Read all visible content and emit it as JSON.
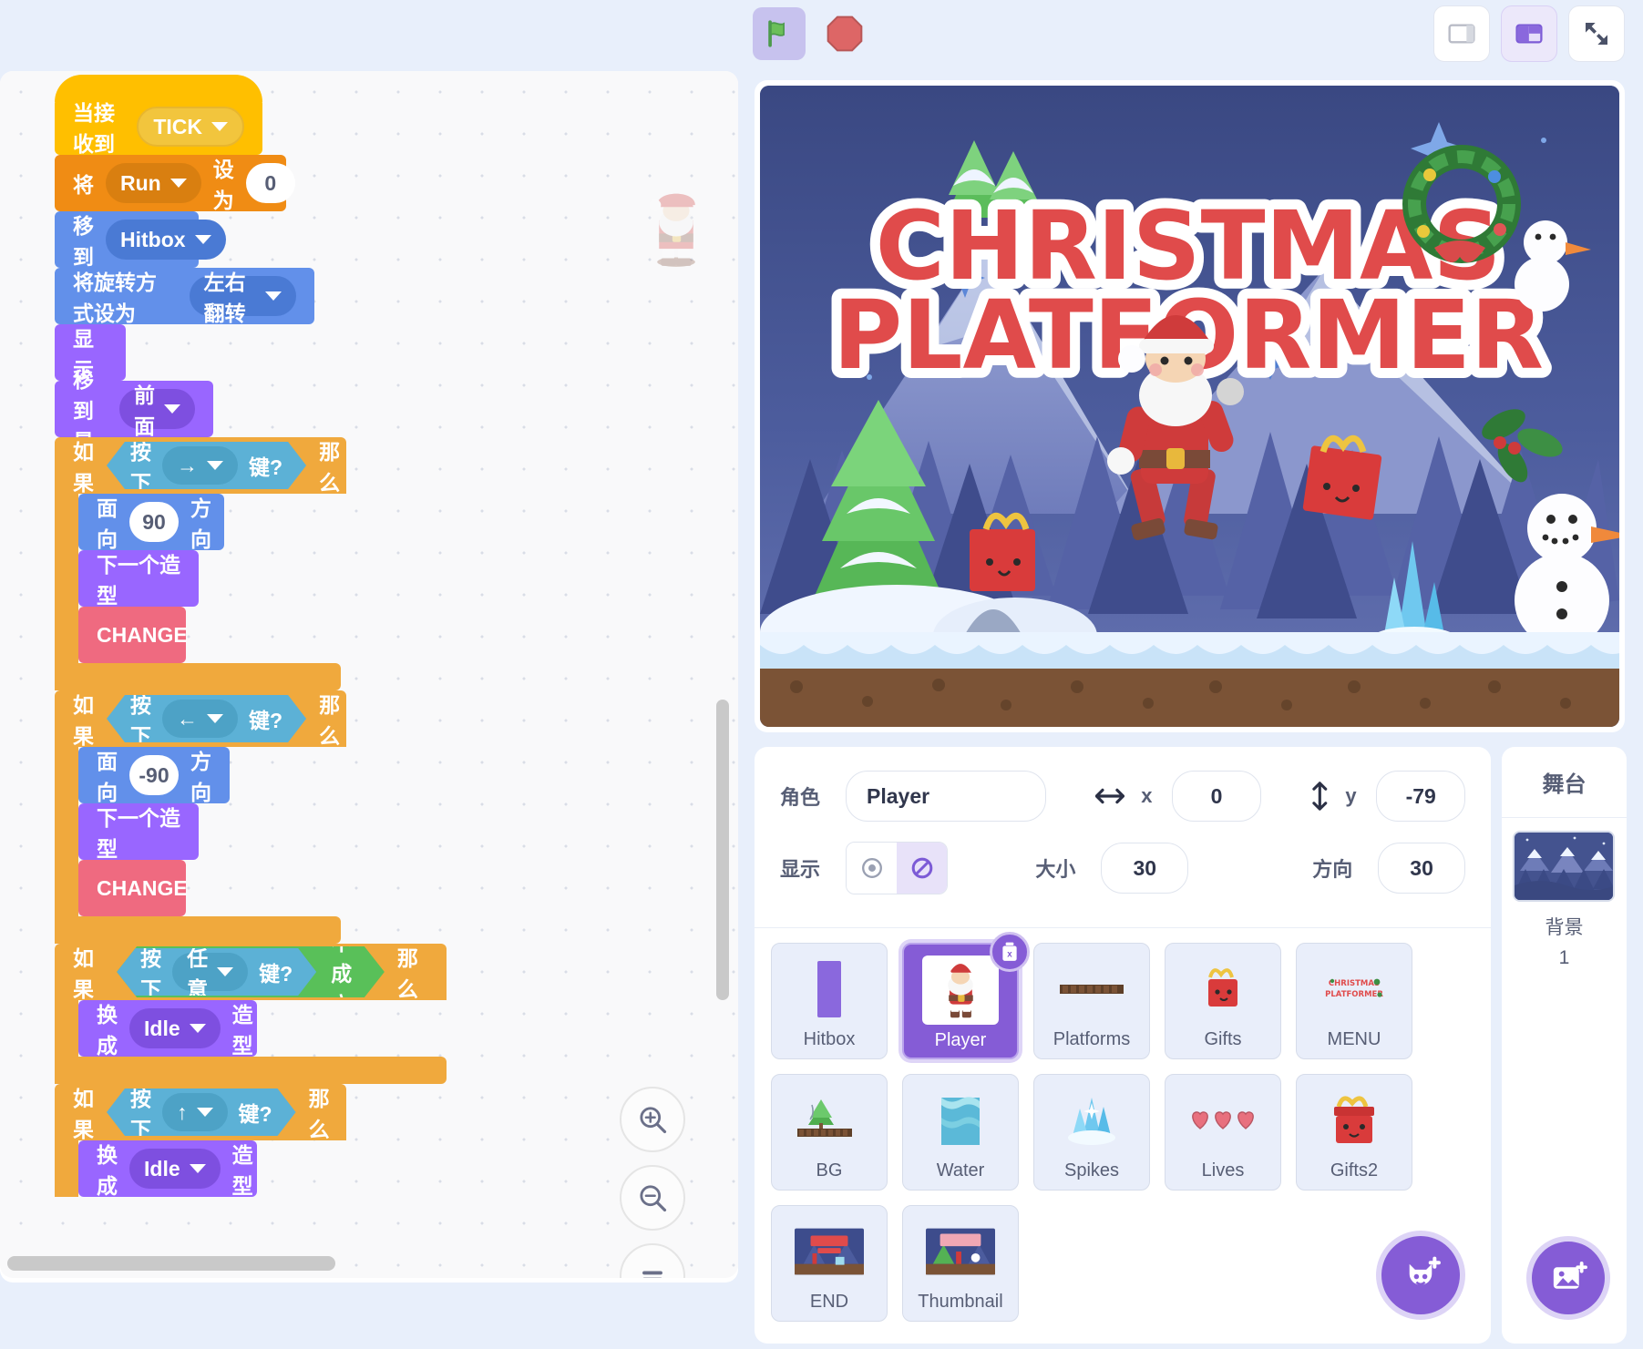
{
  "toolbar": {
    "green_flag": "green-flag-icon",
    "stop": "stop-icon",
    "layout_small": "layout-small-stage-icon",
    "layout_large": "layout-large-stage-icon",
    "fullscreen": "fullscreen-icon"
  },
  "code": {
    "blocks": {
      "when_receive": "当接收到",
      "tick_message": "TICK",
      "set": "将",
      "set_var": "Run",
      "set_to": "设为",
      "set_value": "0",
      "goto": "移到",
      "goto_target": "Hitbox",
      "set_rotation": "将旋转方式设为",
      "rotation_style": "左右翻转",
      "show": "显示",
      "go_to_layer": "移到最",
      "layer_front": "前面",
      "if": "如果",
      "key_pressed": "按下",
      "key_suffix": "键?",
      "then": "那么",
      "key_right": "→",
      "key_left": "←",
      "key_up": "↑",
      "key_any": "任意",
      "not": "不成立",
      "point_direction": "面向",
      "direction_suffix": "方向",
      "dir_90": "90",
      "dir_neg90": "-90",
      "next_costume": "下一个造型",
      "change_custom": "CHANGE",
      "switch_costume": "换成",
      "costume_idle": "Idle",
      "costume_suffix": "造型"
    },
    "zoom_in": "zoom-in-icon",
    "zoom_out": "zoom-out-icon",
    "zoom_reset": "zoom-reset-icon"
  },
  "stage": {
    "title_line1": "CHRISTMAS",
    "title_line2": "PLATFORMER"
  },
  "sprite_info": {
    "name_label": "角色",
    "name_value": "Player",
    "x_label": "x",
    "x_value": "0",
    "y_label": "y",
    "y_value": "-79",
    "show_label": "显示",
    "size_label": "大小",
    "size_value": "30",
    "direction_label": "方向",
    "direction_value": "30"
  },
  "sprites": [
    {
      "name": "Hitbox",
      "icon": "hitbox-rect-icon",
      "selected": false
    },
    {
      "name": "Player",
      "icon": "santa-icon",
      "selected": true
    },
    {
      "name": "Platforms",
      "icon": "platform-icon",
      "selected": false
    },
    {
      "name": "Gifts",
      "icon": "gift-icon",
      "selected": false
    },
    {
      "name": "MENU",
      "icon": "menu-title-icon",
      "selected": false
    },
    {
      "name": "BG",
      "icon": "bg-icon",
      "selected": false
    },
    {
      "name": "Water",
      "icon": "water-icon",
      "selected": false
    },
    {
      "name": "Spikes",
      "icon": "crystal-icon",
      "selected": false
    },
    {
      "name": "Lives",
      "icon": "hearts-icon",
      "selected": false
    },
    {
      "name": "Gifts2",
      "icon": "gift-big-icon",
      "selected": false
    },
    {
      "name": "END",
      "icon": "end-screen-icon",
      "selected": false
    },
    {
      "name": "Thumbnail",
      "icon": "thumbnail-icon",
      "selected": false
    }
  ],
  "add_sprite_button": "add-sprite-icon",
  "stage_panel": {
    "header": "舞台",
    "backdrop_label": "背景",
    "backdrop_count": "1",
    "add_backdrop_button": "add-backdrop-icon"
  },
  "colors": {
    "events": "#ffbf00",
    "data": "#f08c14",
    "motion": "#6290ea",
    "looks": "#9966ff",
    "control": "#f0a93d",
    "sensing": "#5cb1d6",
    "operators": "#59c059",
    "custom": "#ef6a80",
    "accent": "#855cd6"
  }
}
